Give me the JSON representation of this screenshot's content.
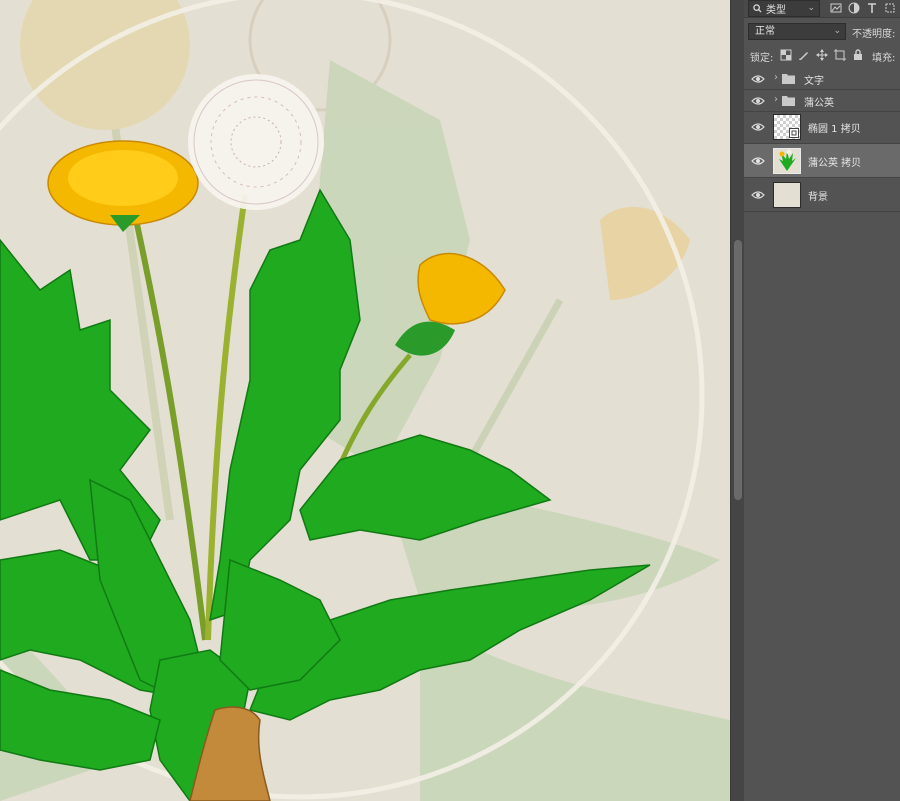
{
  "layers_panel": {
    "filter": {
      "search_icon": "search-icon",
      "kind_label": "类型",
      "filter_icons": [
        "image-filter-icon",
        "adjustment-filter-icon",
        "type-filter-icon",
        "shape-filter-icon"
      ]
    },
    "blend_mode": "正常",
    "opacity_label": "不透明度:",
    "lock_label": "锁定:",
    "lock_icons": [
      "lock-transparency-icon",
      "lock-image-icon",
      "lock-position-icon",
      "lock-artboard-icon",
      "lock-all-icon"
    ],
    "fill_label": "填充:",
    "layers": [
      {
        "name": "文字",
        "type": "group",
        "visible": true,
        "selected": false
      },
      {
        "name": "蒲公英",
        "type": "group",
        "visible": true,
        "selected": false
      },
      {
        "name": "椭圆 1 拷贝",
        "type": "layer",
        "visible": true,
        "selected": false,
        "thumbnail": "transparent-smart-object"
      },
      {
        "name": "蒲公英 拷贝",
        "type": "layer",
        "visible": true,
        "selected": true,
        "thumbnail": "dandelion"
      },
      {
        "name": "背景",
        "type": "layer",
        "visible": true,
        "selected": false,
        "thumbnail": "solid-beige"
      }
    ]
  },
  "colors": {
    "canvas_bg": "#e4dfd3",
    "panel_bg": "#535353",
    "selected_layer": "#6a6a6a",
    "leaf_green": "#1faa1f",
    "flower_yellow": "#f5b800"
  }
}
